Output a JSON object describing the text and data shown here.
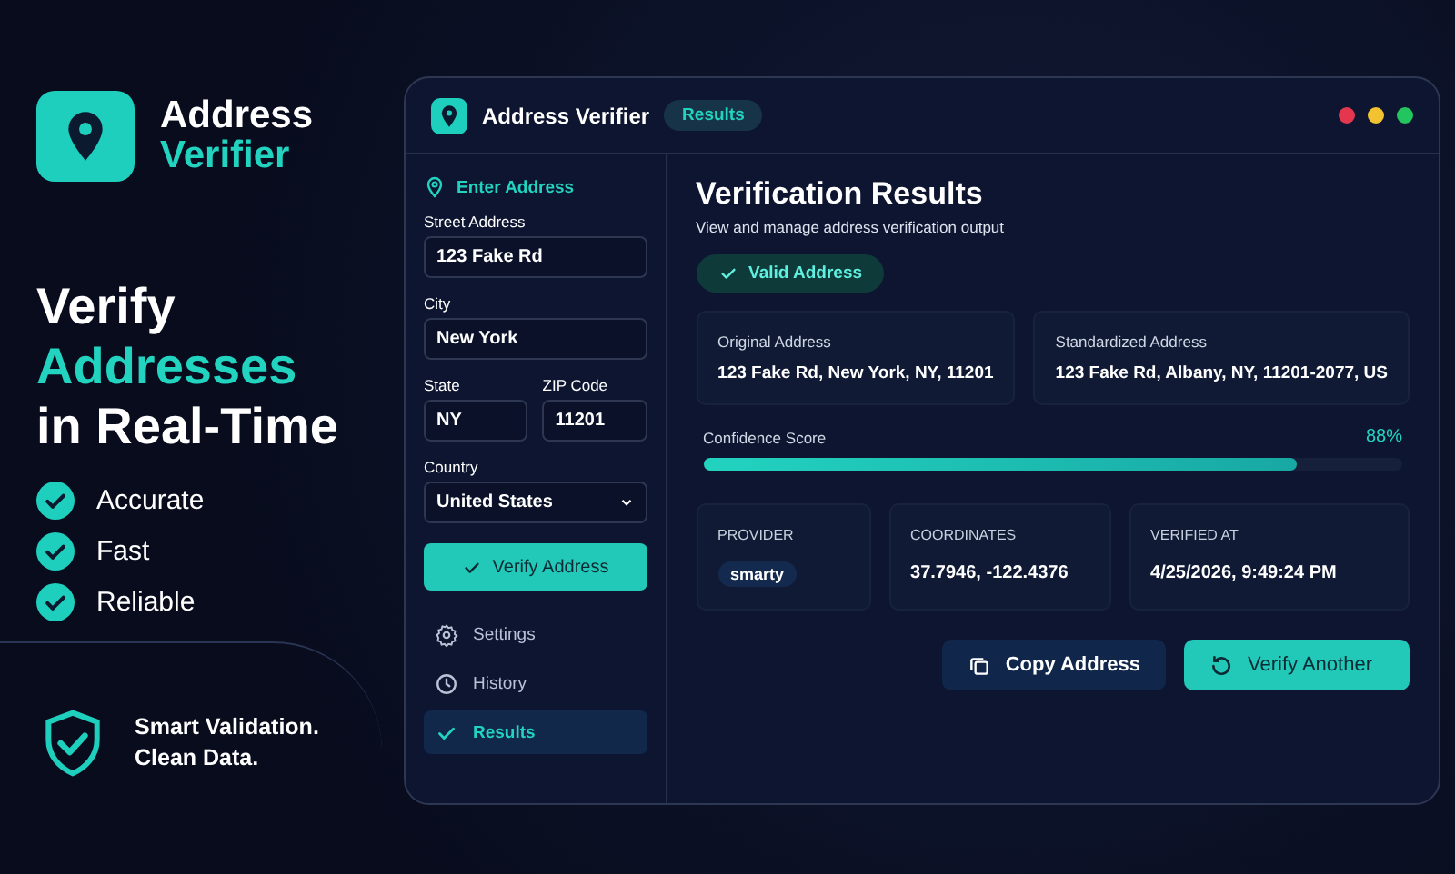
{
  "brand": {
    "line_1": "Address",
    "line_2": "Verifier"
  },
  "headline": {
    "line_1": "Verify",
    "line_2": "Addresses",
    "line_3": "in Real-Time"
  },
  "features": [
    "Accurate",
    "Fast",
    "Reliable"
  ],
  "tagline": {
    "line_1": "Smart Validation.",
    "line_2": "Clean Data."
  },
  "window": {
    "title": "Address Verifier",
    "badge": "Results",
    "controls": [
      {
        "color": "#e5364f"
      },
      {
        "color": "#f2c230"
      },
      {
        "color": "#22c55e"
      }
    ]
  },
  "form": {
    "heading": "Enter Address",
    "fields": [
      {
        "label": "Street Address",
        "value": "123 Fake Rd"
      },
      {
        "label": "City",
        "value": "New York"
      }
    ],
    "pair": [
      {
        "label": "State",
        "value": "NY"
      },
      {
        "label": "ZIP Code",
        "value": "11201"
      }
    ],
    "country": {
      "label": "Country",
      "value": "United States"
    },
    "submit": "Verify Address"
  },
  "nav": [
    {
      "kind": "gear",
      "label": "Settings",
      "selected": false
    },
    {
      "kind": "clock",
      "label": "History",
      "selected": false
    },
    {
      "kind": "check",
      "label": "Results",
      "selected": true
    }
  ],
  "results": {
    "title": "Verification Results",
    "subtitle": "View and manage address verification output",
    "status": "Valid Address",
    "addresses": [
      {
        "label": "Original Address",
        "value": "123 Fake Rd, New York, NY, 11201"
      },
      {
        "label": "Standardized Address",
        "value": "123 Fake Rd, Albany, NY, 11201-2077, US"
      }
    ],
    "confidence": {
      "label": "Confidence Score",
      "reading": "88%",
      "level": 0.85
    },
    "details": [
      {
        "kind": "tag",
        "label": "PROVIDER",
        "value": "smarty"
      },
      {
        "kind": "text",
        "label": "COORDINATES",
        "value": "37.7946, -122.4376"
      },
      {
        "kind": "text",
        "label": "VERIFIED AT",
        "value": "4/25/2026, 9:49:24 PM"
      }
    ],
    "buttons": [
      {
        "kind": "secondary",
        "label": "Copy Address"
      },
      {
        "kind": "primary",
        "label": "Verify Another"
      }
    ]
  }
}
